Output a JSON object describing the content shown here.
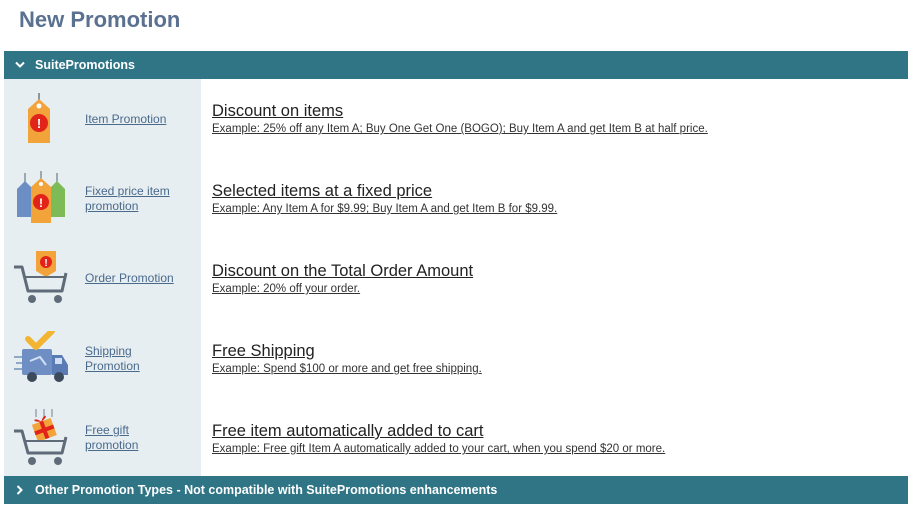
{
  "page": {
    "title": "New Promotion"
  },
  "sections": {
    "suite": {
      "label": "SuitePromotions",
      "expanded": true
    },
    "other": {
      "label": "Other Promotion Types - Not compatible with SuitePromotions enhancements",
      "expanded": false
    }
  },
  "promotions": [
    {
      "icon": "price-tag-icon",
      "type_label": "Item Promotion",
      "title": "Discount on items",
      "example": "Example: 25% off any Item A; Buy One Get One (BOGO); Buy Item A and get Item B at half price."
    },
    {
      "icon": "multiple-price-tags-icon",
      "type_label": "Fixed price item promotion",
      "title": "Selected items at a fixed price",
      "example": "Example: Any Item A for $9.99; Buy Item A and get Item B for $9.99."
    },
    {
      "icon": "cart-with-tag-icon",
      "type_label": "Order Promotion",
      "title": "Discount on the Total Order Amount",
      "example": "Example: 20% off your order."
    },
    {
      "icon": "delivery-truck-check-icon",
      "type_label": "Shipping Promotion",
      "title": "Free Shipping",
      "example": "Example: Spend $100 or more and get free shipping."
    },
    {
      "icon": "cart-with-gift-icon",
      "type_label": "Free gift promotion",
      "title": "Free item automatically added to cart",
      "example": "Example: Free gift Item A automatically added to your cart, when you spend $20 or more."
    }
  ],
  "colors": {
    "header_bar": "#2f7586",
    "left_panel": "#e7eef1",
    "title": "#5b7190",
    "tag_orange": "#f2a33a",
    "badge_red": "#e2231a",
    "cart_gray": "#5f6b78"
  }
}
